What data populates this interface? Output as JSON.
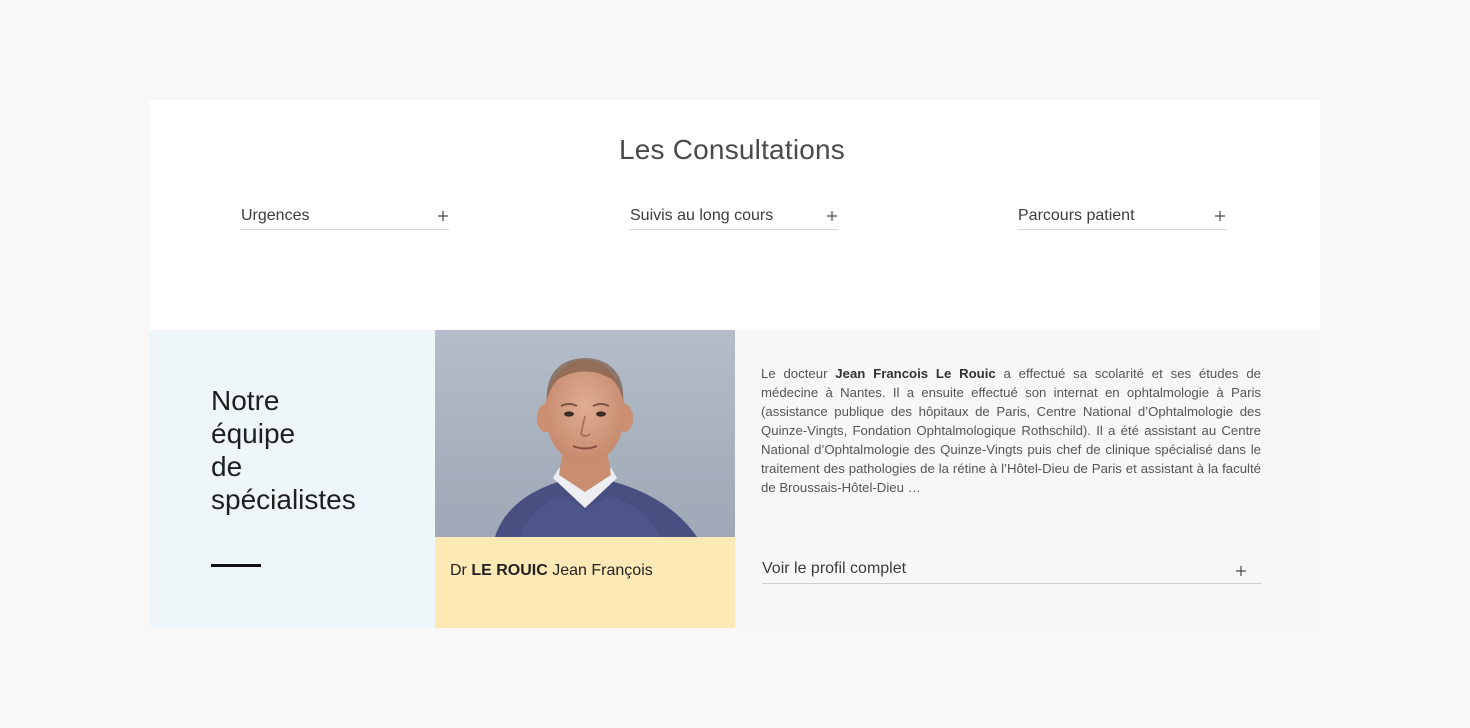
{
  "consultations": {
    "title": "Les Consultations",
    "items": [
      {
        "label": "Urgences",
        "icon": "plus-icon"
      },
      {
        "label": "Suivis au long cours",
        "icon": "plus-icon"
      },
      {
        "label": "Parcours patient",
        "icon": "plus-icon"
      }
    ]
  },
  "team": {
    "heading_lines": [
      "Notre",
      "équipe",
      "de",
      "spécialistes"
    ],
    "doctor": {
      "prefix": "Dr",
      "surname": "LE ROUIC",
      "firstname": "Jean François"
    },
    "bio": {
      "intro": "Le docteur",
      "name": "Jean Francois Le Rouic",
      "text": "a effectué sa scolarité et ses études de médecine à Nantes. Il a ensuite effectué son internat en ophtalmologie à Paris (assistance publique des hôpitaux de Paris, Centre National d’Ophtalmologie des Quinze-Vingts, Fondation Ophtalmologique Rothschild). Il a été assistant au Centre National d’Ophtalmologie des Quinze-Vingts puis chef de clinique spécialisé dans le traitement des pathologies de la rétine à l’Hôtel-Dieu de Paris et assistant à la faculté de Broussais-Hôtel-Dieu …"
    },
    "profile_link": {
      "label": "Voir le profil complet",
      "icon": "plus-icon"
    }
  },
  "colors": {
    "page_bg": "#f8f8f8",
    "heading_panel_bg": "#eef6f9",
    "name_box_bg": "#fde9b6",
    "bio_panel_bg": "#f7f7f7"
  }
}
